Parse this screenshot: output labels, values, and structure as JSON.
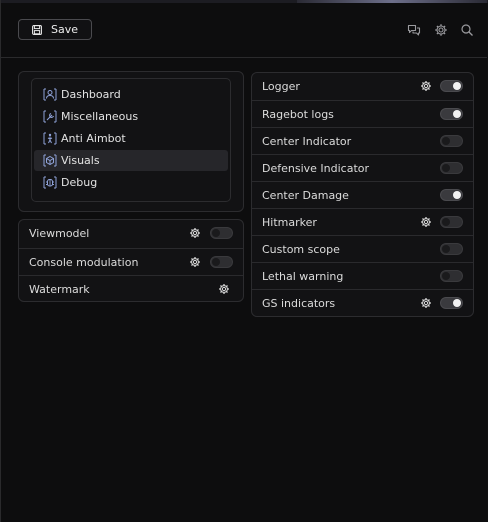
{
  "toolbar": {
    "save_label": "Save"
  },
  "header_icons": [
    "chat-icon",
    "gear-icon",
    "search-icon"
  ],
  "nav": {
    "items": [
      {
        "label": "Dashboard",
        "icon": "dashboard-icon"
      },
      {
        "label": "Miscellaneous",
        "icon": "wrench-icon"
      },
      {
        "label": "Anti Aimbot",
        "icon": "person-icon"
      },
      {
        "label": "Visuals",
        "icon": "cube-icon",
        "active": true
      },
      {
        "label": "Debug",
        "icon": "bug-icon"
      }
    ]
  },
  "left_panel": {
    "rows": [
      {
        "label": "Viewmodel",
        "gear": true,
        "toggle": false
      },
      {
        "label": "Console modulation",
        "gear": true,
        "toggle": false
      },
      {
        "label": "Watermark",
        "gear": true
      }
    ]
  },
  "right_panel": {
    "rows": [
      {
        "label": "Logger",
        "gear": true,
        "toggle": true
      },
      {
        "label": "Ragebot logs",
        "gear": false,
        "toggle": true
      },
      {
        "label": "Center Indicator",
        "gear": false,
        "toggle": false
      },
      {
        "label": "Defensive Indicator",
        "gear": false,
        "toggle": false
      },
      {
        "label": "Center Damage",
        "gear": false,
        "toggle": true
      },
      {
        "label": "Hitmarker",
        "gear": true,
        "toggle": false
      },
      {
        "label": "Custom scope",
        "gear": false,
        "toggle": false
      },
      {
        "label": "Lethal warning",
        "gear": false,
        "toggle": false
      },
      {
        "label": "GS indicators",
        "gear": true,
        "toggle": true
      }
    ]
  },
  "colors": {
    "background": "#0d0d0e",
    "panel": "#121214",
    "toggle_on_knob": "#f2f2f2"
  }
}
